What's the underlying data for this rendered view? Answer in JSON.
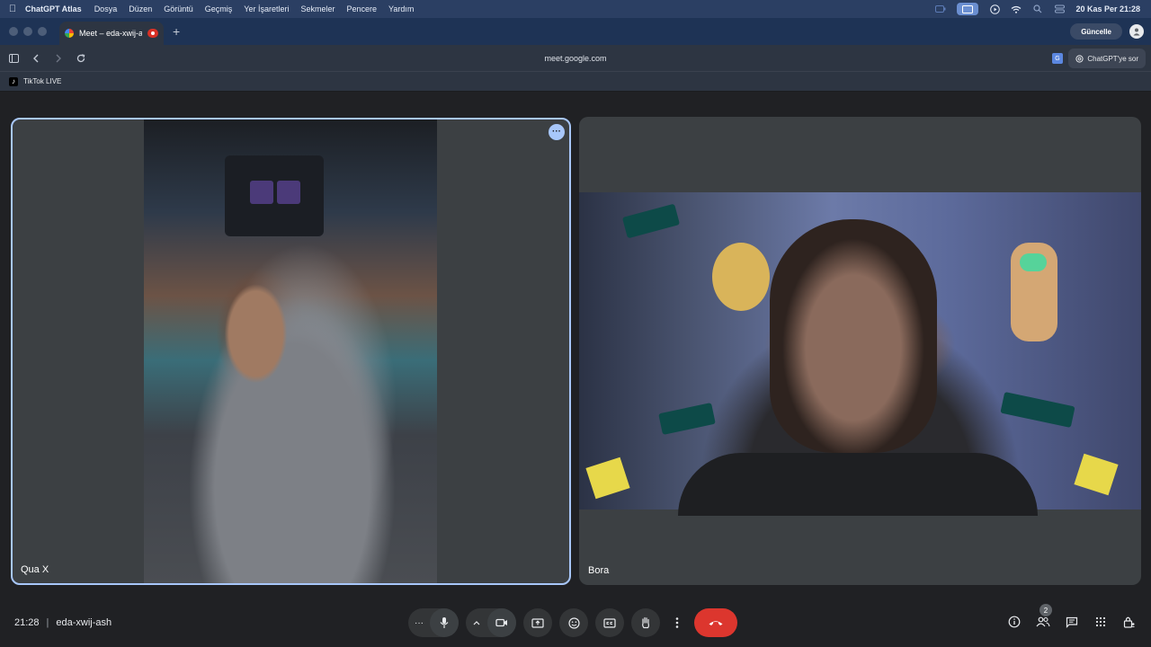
{
  "menubar": {
    "app_name": "ChatGPT Atlas",
    "items": [
      "Dosya",
      "Düzen",
      "Görüntü",
      "Geçmiş",
      "Yer İşaretleri",
      "Sekmeler",
      "Pencere",
      "Yardım"
    ],
    "clock": "20 Kas Per  21:28"
  },
  "browser": {
    "tab_title": "Meet – eda-xwij-ash",
    "new_tab_symbol": "+",
    "update_label": "Güncelle",
    "url": "meet.google.com",
    "ask_label": "ChatGPT'ye sor",
    "bookmark_label": "TikTok LIVE"
  },
  "meet": {
    "participants": [
      {
        "name": "Qua X"
      },
      {
        "name": "Bora"
      }
    ],
    "time": "21:28",
    "separator": "|",
    "meeting_code": "eda-xwij-ash",
    "participant_count": "2"
  },
  "colors": {
    "menubar_bg": "#2b3f63",
    "tabstrip_bg": "#1e3355",
    "page_bg": "#202124",
    "active_tile_border": "#a8c7fa",
    "end_call": "#dc362e"
  }
}
